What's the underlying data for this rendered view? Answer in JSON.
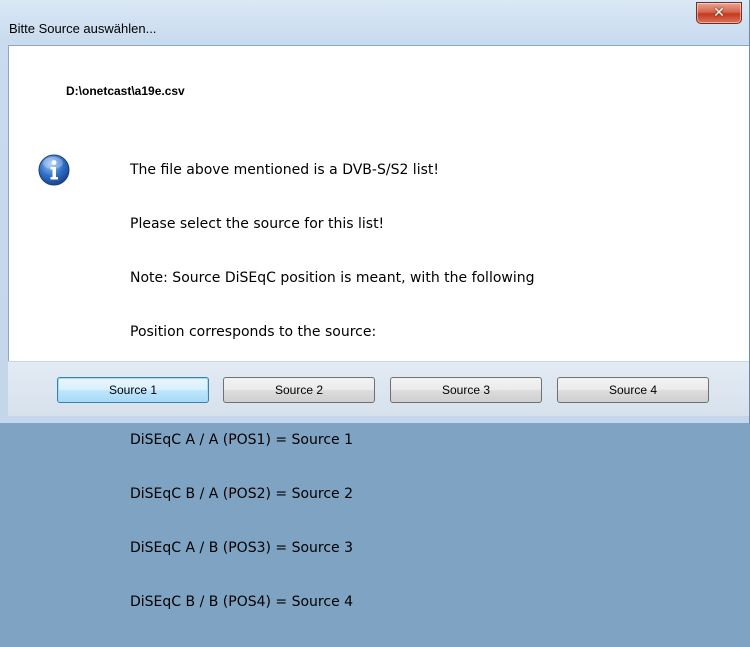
{
  "window": {
    "title": "Bitte Source auswählen...",
    "close_glyph": "✕"
  },
  "file_path": "D:\\onetcast\\a19e.csv",
  "icon": "info-icon",
  "message": {
    "lines": [
      "The file above mentioned is a DVB-S/S2 list!",
      "Please select the source for this list!",
      "Note: Source DiSEqC position is meant, with the following",
      "Position corresponds to the source:",
      "",
      "DiSEqC A / A (POS1) = Source 1",
      "DiSEqC B / A (POS2) = Source 2",
      "DiSEqC A / B (POS3) = Source 3",
      "DiSEqC B / B (POS4) = Source 4"
    ]
  },
  "buttons": [
    {
      "label": "Source 1",
      "default": true
    },
    {
      "label": "Source 2",
      "default": false
    },
    {
      "label": "Source 3",
      "default": false
    },
    {
      "label": "Source 4",
      "default": false
    }
  ],
  "colors": {
    "close_button": "#c43b1e",
    "default_button_border": "#3c7fb1",
    "info_icon": "#2b64b8"
  }
}
